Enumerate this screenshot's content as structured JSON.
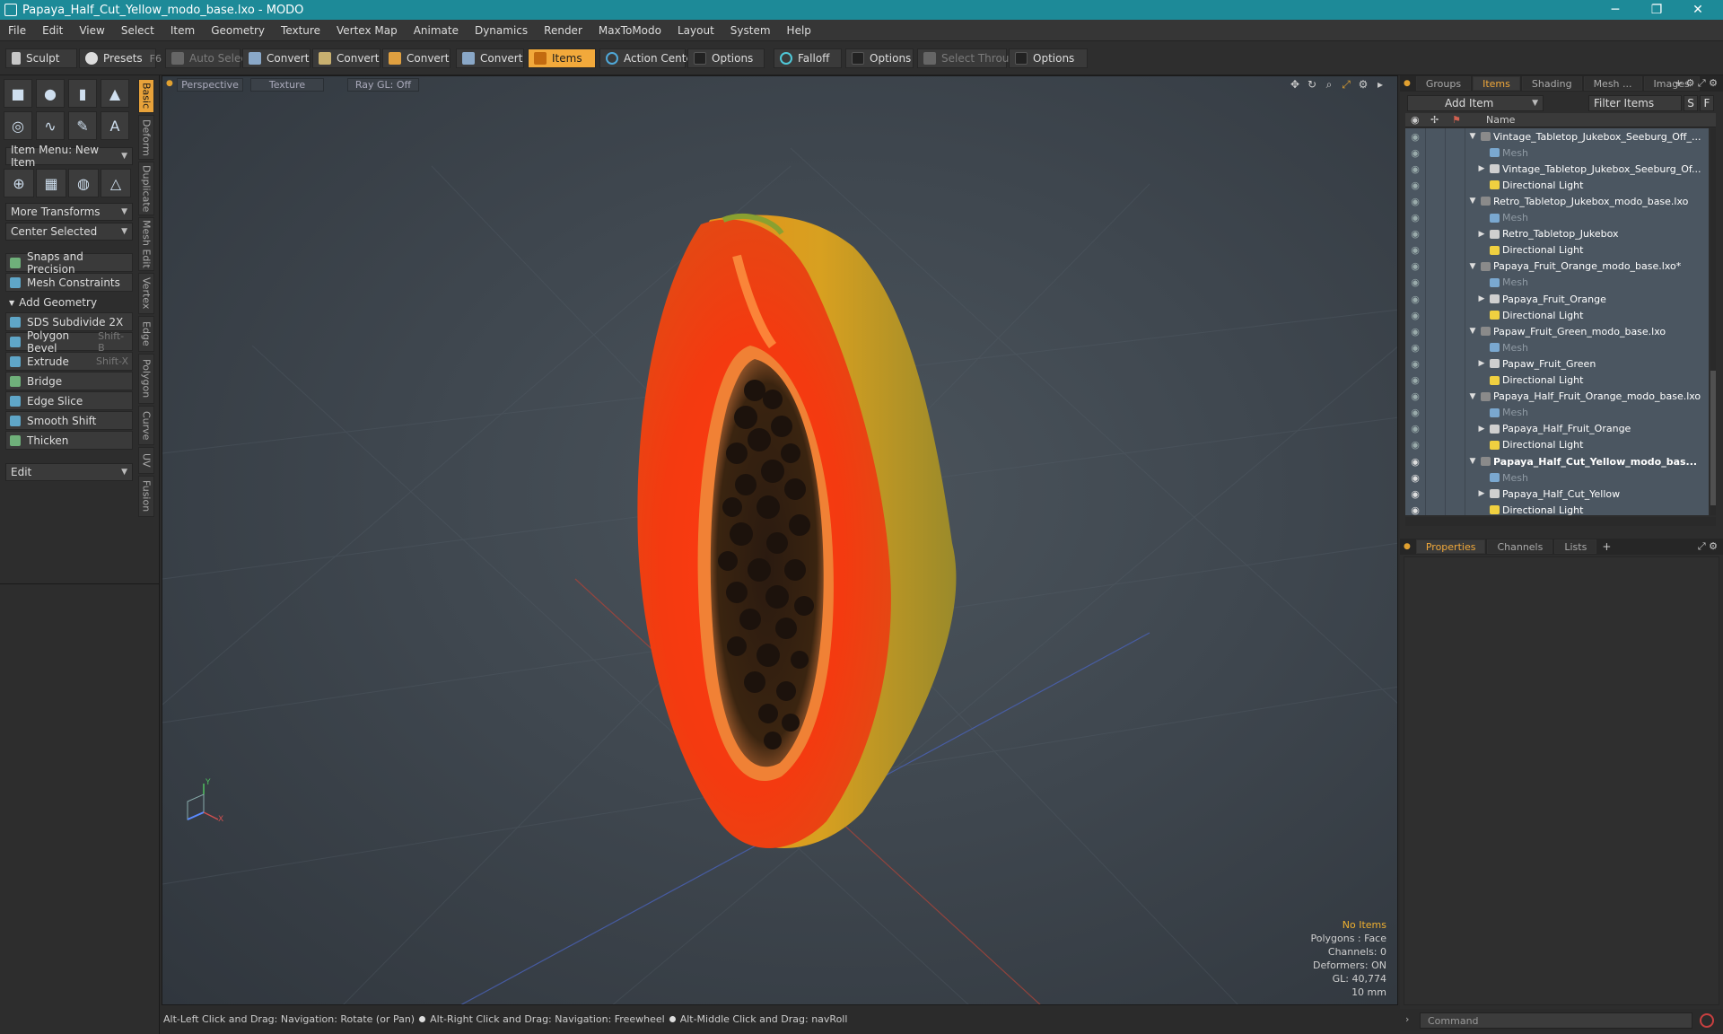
{
  "window": {
    "title": "Papaya_Half_Cut_Yellow_modo_base.lxo - MODO",
    "minimize": "─",
    "maximize": "❐",
    "close": "✕"
  },
  "menu": [
    "File",
    "Edit",
    "View",
    "Select",
    "Item",
    "Geometry",
    "Texture",
    "Vertex Map",
    "Animate",
    "Dynamics",
    "Render",
    "MaxToModo",
    "Layout",
    "System",
    "Help"
  ],
  "toolbar": {
    "sculpt": "Sculpt",
    "presets": "Presets",
    "presets_key": "F6",
    "auto_select": "Auto Select",
    "convert1": "Convert",
    "convert2": "Convert",
    "convert3": "Convert",
    "convert4": "Convert",
    "items": "Items",
    "action_center": "Action Center",
    "options1": "Options",
    "falloff": "Falloff",
    "options2": "Options",
    "select_through": "Select Through",
    "options3": "Options"
  },
  "left": {
    "item_menu": "Item Menu: New Item",
    "more_transforms": "More Transforms",
    "center_selected": "Center Selected",
    "snaps": "Snaps and Precision",
    "mesh_constraints": "Mesh Constraints",
    "add_geometry": "Add Geometry",
    "tools": [
      {
        "label": "SDS Subdivide 2X",
        "key": ""
      },
      {
        "label": "Polygon Bevel",
        "key": "Shift-B"
      },
      {
        "label": "Extrude",
        "key": "Shift-X"
      },
      {
        "label": "Bridge",
        "key": ""
      },
      {
        "label": "Edge Slice",
        "key": ""
      },
      {
        "label": "Smooth Shift",
        "key": ""
      },
      {
        "label": "Thicken",
        "key": ""
      }
    ],
    "edit": "Edit",
    "vtabs": [
      "Basic",
      "Deform",
      "Duplicate",
      "Mesh Edit",
      "Vertex",
      "Edge",
      "Polygon",
      "Curve",
      "UV",
      "Fusion"
    ]
  },
  "viewport": {
    "perspective": "Perspective",
    "texture": "Texture",
    "raygl": "Ray GL: Off",
    "stats": [
      "No Items",
      "Polygons : Face",
      "Channels: 0",
      "Deformers: ON",
      "GL: 40,774",
      "10 mm"
    ],
    "axis_y": "Y",
    "axis_x": "X"
  },
  "status": {
    "s1": "Alt-Left Click and Drag: Navigation: Rotate (or Pan)",
    "s2": "Alt-Right Click and Drag: Navigation: Freewheel",
    "s3": "Alt-Middle Click and Drag: navRoll"
  },
  "right": {
    "tabs": [
      "Groups",
      "Items",
      "Shading",
      "Mesh ...",
      "Images"
    ],
    "add_item": "Add Item",
    "filter_items": "Filter Items",
    "s_btn": "S",
    "f_btn": "F",
    "name_col": "Name",
    "items": [
      {
        "depth": 0,
        "label": "Vintage_Tabletop_Jukebox_Seeburg_Off_...",
        "type": "scene"
      },
      {
        "depth": 1,
        "label": "Mesh",
        "type": "mesh"
      },
      {
        "depth": 1,
        "label": "Vintage_Tabletop_Jukebox_Seeburg_Of...",
        "type": "group"
      },
      {
        "depth": 1,
        "label": "Directional Light",
        "type": "light"
      },
      {
        "depth": 0,
        "label": "Retro_Tabletop_Jukebox_modo_base.lxo",
        "type": "scene"
      },
      {
        "depth": 1,
        "label": "Mesh",
        "type": "mesh"
      },
      {
        "depth": 1,
        "label": "Retro_Tabletop_Jukebox",
        "type": "group"
      },
      {
        "depth": 1,
        "label": "Directional Light",
        "type": "light"
      },
      {
        "depth": 0,
        "label": "Papaya_Fruit_Orange_modo_base.lxo*",
        "type": "scene"
      },
      {
        "depth": 1,
        "label": "Mesh",
        "type": "mesh"
      },
      {
        "depth": 1,
        "label": "Papaya_Fruit_Orange",
        "type": "group"
      },
      {
        "depth": 1,
        "label": "Directional Light",
        "type": "light"
      },
      {
        "depth": 0,
        "label": "Papaw_Fruit_Green_modo_base.lxo",
        "type": "scene"
      },
      {
        "depth": 1,
        "label": "Mesh",
        "type": "mesh"
      },
      {
        "depth": 1,
        "label": "Papaw_Fruit_Green",
        "type": "group"
      },
      {
        "depth": 1,
        "label": "Directional Light",
        "type": "light"
      },
      {
        "depth": 0,
        "label": "Papaya_Half_Fruit_Orange_modo_base.lxo",
        "type": "scene"
      },
      {
        "depth": 1,
        "label": "Mesh",
        "type": "mesh"
      },
      {
        "depth": 1,
        "label": "Papaya_Half_Fruit_Orange",
        "type": "group"
      },
      {
        "depth": 1,
        "label": "Directional Light",
        "type": "light"
      },
      {
        "depth": 0,
        "label": "Papaya_Half_Cut_Yellow_modo_bas...",
        "type": "scene",
        "bold": true
      },
      {
        "depth": 1,
        "label": "Mesh",
        "type": "mesh"
      },
      {
        "depth": 1,
        "label": "Papaya_Half_Cut_Yellow",
        "type": "group"
      },
      {
        "depth": 1,
        "label": "Directional Light",
        "type": "light"
      }
    ],
    "bottom_tabs": [
      "Properties",
      "Channels",
      "Lists"
    ],
    "command_placeholder": "Command"
  }
}
